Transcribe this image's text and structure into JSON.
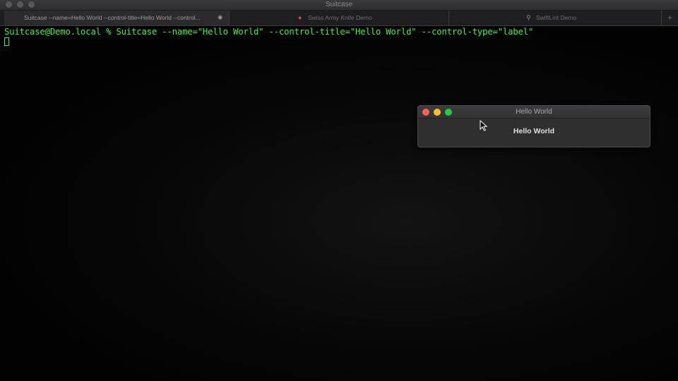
{
  "window": {
    "title": "Suitcase"
  },
  "tabs": [
    {
      "label": "Suitcase --name=Hello World --control-title=Hello World --control...",
      "icon": "spinner-icon",
      "active": true
    },
    {
      "label": "Swiss Army Knife Demo",
      "icon": "record-dot-icon",
      "active": false
    },
    {
      "label": "SwiftLint Demo",
      "icon": "microscope-icon",
      "active": false
    }
  ],
  "new_tab_label": "+",
  "terminal": {
    "prompt_line": "Suitcase@Demo.local % Suitcase --name=\"Hello World\" --control-title=\"Hello World\" --control-type=\"label\""
  },
  "hello_window": {
    "title": "Hello World",
    "label": "Hello World"
  },
  "colors": {
    "terminal_text": "#3ff23a",
    "close": "#fe5f57",
    "minimize": "#febc2e",
    "zoom": "#28c840"
  }
}
